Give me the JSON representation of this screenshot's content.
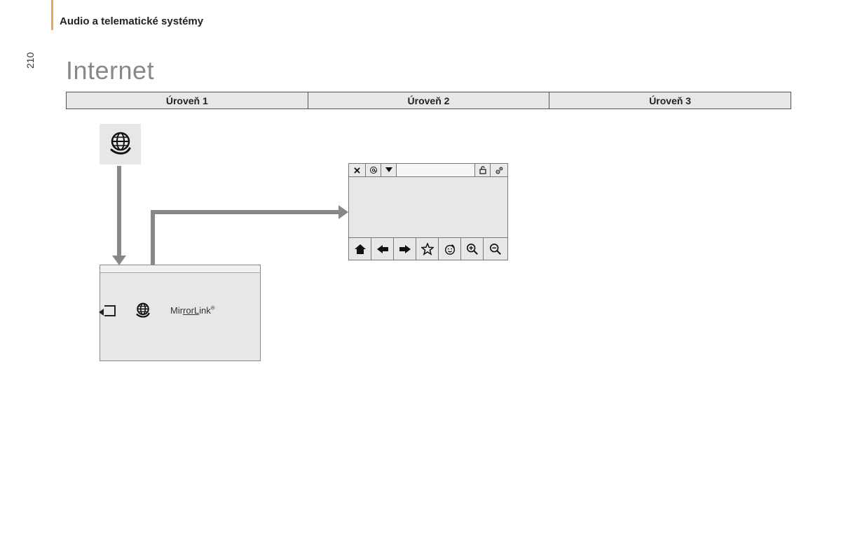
{
  "page": {
    "section_header": "Audio a telematické systémy",
    "page_number": "210",
    "title": "Internet"
  },
  "levels": {
    "col1": "Úroveň 1",
    "col2": "Úroveň 2",
    "col3": "Úroveň 3"
  },
  "menu_box": {
    "mirrorlink_label": "MirrorLink"
  },
  "browser_icons": {
    "close": "✕",
    "at": "@",
    "dropdown": "▼",
    "lock": "lock",
    "gear": "gear",
    "home": "home",
    "back": "←",
    "forward": "→",
    "star": "☆",
    "face": "☺",
    "zoom_in": "+",
    "zoom_out": "−"
  }
}
